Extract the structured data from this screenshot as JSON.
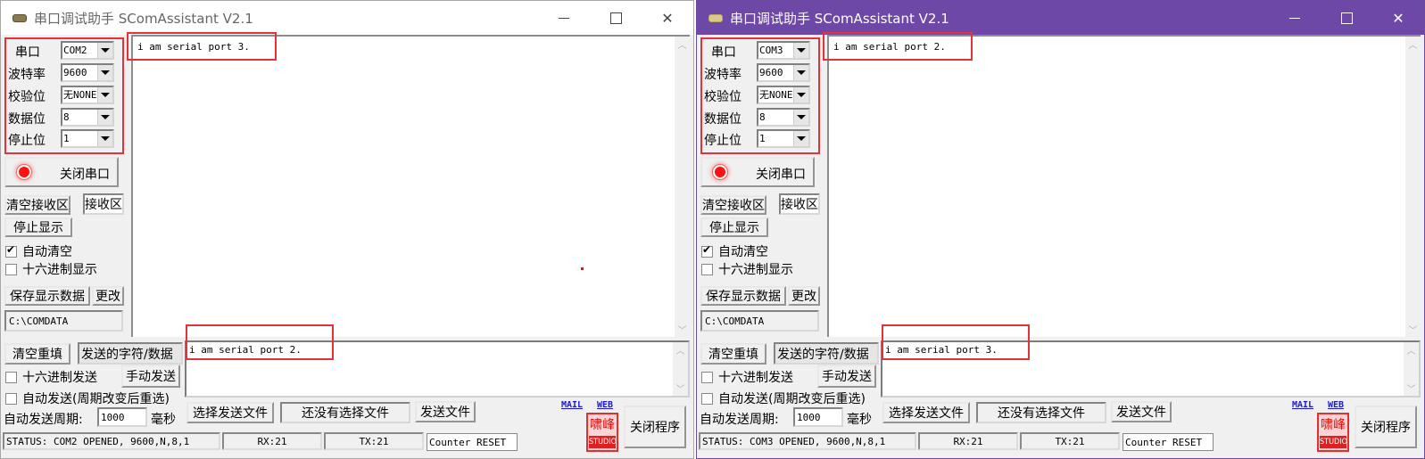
{
  "windows": [
    {
      "title": "串口调试助手 SComAssistant V2.1",
      "controls": {
        "minimize": "minimize",
        "maximize": "maximize",
        "close": "✕"
      },
      "settings": {
        "port": {
          "label": "串口",
          "value": "COM2"
        },
        "baud": {
          "label": "波特率",
          "value": "9600"
        },
        "parity": {
          "label": "校验位",
          "value": "无NONE"
        },
        "databits": {
          "label": "数据位",
          "value": "8"
        },
        "stopbits": {
          "label": "停止位",
          "value": "1"
        }
      },
      "close_port_label": "关闭串口",
      "clear_recv_label": "清空接收区",
      "recv_area_label": "接收区",
      "stop_display_label": "停止显示",
      "auto_clear": {
        "label": "自动清空",
        "checked": true
      },
      "hex_display": {
        "label": "十六进制显示",
        "checked": false
      },
      "save_data_label": "保存显示数据",
      "change_label": "更改",
      "save_path": "C:\\COMDATA",
      "received_text": "i am serial port 3.",
      "clear_send_label": "清空重填",
      "send_chars_label": "发送的字符/数据",
      "send_text": "i am serial port 2.",
      "hex_send": {
        "label": "十六进制发送",
        "checked": false
      },
      "manual_send_label": "手动发送",
      "auto_send": {
        "label": "自动发送(周期改变后重选)",
        "checked": false
      },
      "auto_period_label": "自动发送周期:",
      "auto_period_value": "1000",
      "auto_period_unit": "毫秒",
      "select_file_label": "选择发送文件",
      "no_file_label": "还没有选择文件",
      "send_file_label": "发送文件",
      "mail_link": "MAIL",
      "web_link": "WEB",
      "logo_top": "啸峰",
      "logo_bottom": "STUDIO",
      "exit_label": "关闭程序",
      "status_text": "STATUS: COM2 OPENED, 9600,N,8,1",
      "rx_text": "RX:21",
      "tx_text": "TX:21",
      "counter_reset_label": "Counter RESET",
      "scroll_up": "︿",
      "scroll_down": "﹀"
    },
    {
      "title": "串口调试助手 SComAssistant V2.1",
      "controls": {
        "minimize": "minimize",
        "maximize": "maximize",
        "close": "✕"
      },
      "settings": {
        "port": {
          "label": "串口",
          "value": "COM3"
        },
        "baud": {
          "label": "波特率",
          "value": "9600"
        },
        "parity": {
          "label": "校验位",
          "value": "无NONE"
        },
        "databits": {
          "label": "数据位",
          "value": "8"
        },
        "stopbits": {
          "label": "停止位",
          "value": "1"
        }
      },
      "close_port_label": "关闭串口",
      "clear_recv_label": "清空接收区",
      "recv_area_label": "接收区",
      "stop_display_label": "停止显示",
      "auto_clear": {
        "label": "自动清空",
        "checked": true
      },
      "hex_display": {
        "label": "十六进制显示",
        "checked": false
      },
      "save_data_label": "保存显示数据",
      "change_label": "更改",
      "save_path": "C:\\COMDATA",
      "received_text": "i am serial port 2.",
      "clear_send_label": "清空重填",
      "send_chars_label": "发送的字符/数据",
      "send_text": "i am serial port 3.",
      "hex_send": {
        "label": "十六进制发送",
        "checked": false
      },
      "manual_send_label": "手动发送",
      "auto_send": {
        "label": "自动发送(周期改变后重选)",
        "checked": false
      },
      "auto_period_label": "自动发送周期:",
      "auto_period_value": "1000",
      "auto_period_unit": "毫秒",
      "select_file_label": "选择发送文件",
      "no_file_label": "还没有选择文件",
      "send_file_label": "发送文件",
      "mail_link": "MAIL",
      "web_link": "WEB",
      "logo_top": "啸峰",
      "logo_bottom": "STUDIO",
      "exit_label": "关闭程序",
      "status_text": "STATUS: COM3 OPENED, 9600,N,8,1",
      "rx_text": "RX:21",
      "tx_text": "TX:21",
      "counter_reset_label": "Counter RESET",
      "scroll_up": "︿",
      "scroll_down": "﹀"
    }
  ]
}
